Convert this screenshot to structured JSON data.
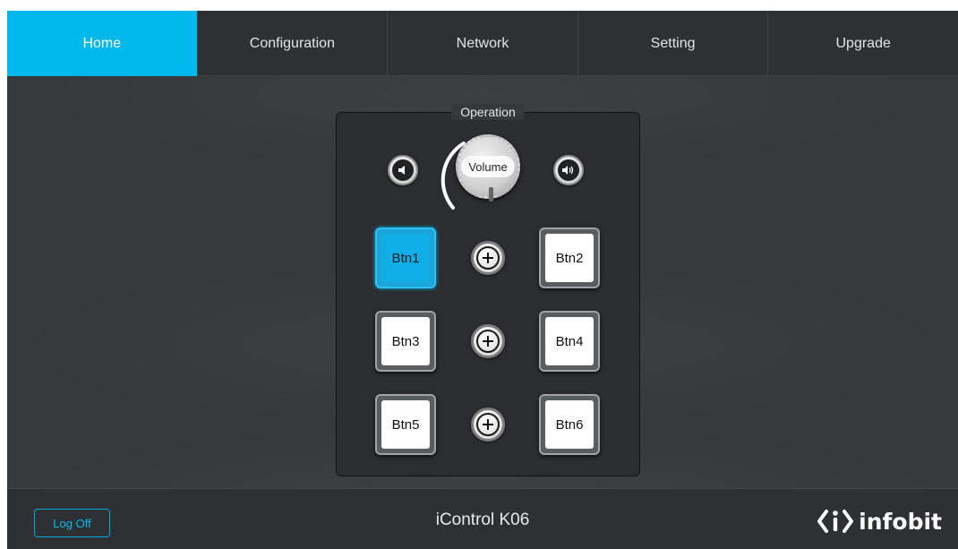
{
  "nav": {
    "tabs": [
      {
        "label": "Home",
        "active": true
      },
      {
        "label": "Configuration",
        "active": false
      },
      {
        "label": "Network",
        "active": false
      },
      {
        "label": "Setting",
        "active": false
      },
      {
        "label": "Upgrade",
        "active": false
      }
    ]
  },
  "panel": {
    "title": "Operation",
    "volume": {
      "label": "Volume",
      "down_icon": "volume-down-icon",
      "up_icon": "volume-up-icon"
    },
    "rows": [
      {
        "left": {
          "label": "Btn1",
          "active": true
        },
        "plus_icon": "plus-icon",
        "right": {
          "label": "Btn2",
          "active": false
        }
      },
      {
        "left": {
          "label": "Btn3",
          "active": false
        },
        "plus_icon": "plus-icon",
        "right": {
          "label": "Btn4",
          "active": false
        }
      },
      {
        "left": {
          "label": "Btn5",
          "active": false
        },
        "plus_icon": "plus-icon",
        "right": {
          "label": "Btn6",
          "active": false
        }
      }
    ]
  },
  "footer": {
    "logoff_label": "Log Off",
    "device_name": "iControl K06",
    "brand": "infobit"
  },
  "colors": {
    "accent": "#00b8ec",
    "background": "#2e3133",
    "panel": "#2b2d2f"
  }
}
